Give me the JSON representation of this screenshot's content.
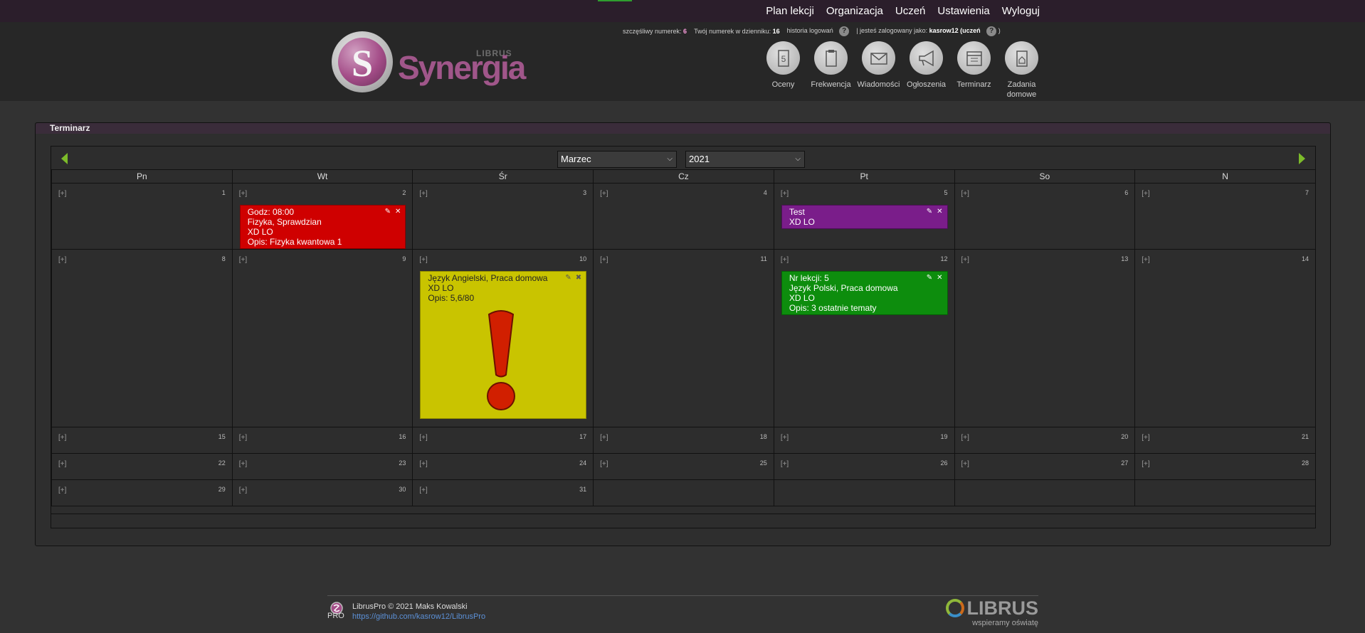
{
  "topnav": {
    "items": [
      "Plan lekcji",
      "Organizacja",
      "Uczeń",
      "Ustawienia",
      "Wyloguj"
    ]
  },
  "header": {
    "logo_text": "Synergia",
    "logo_small": "LIBRUS",
    "info": {
      "lucky_label": "szczęśliwy numerek:",
      "lucky_value": "6",
      "number_label": "Twój numerek w dzienniku:",
      "number_value": "16",
      "history_label": "historia logowań",
      "logged_prefix": "| jesteś zalogowany jako:",
      "logged_user": "kasrow12 (uczeń",
      "logged_suffix": ")"
    },
    "modules": [
      {
        "label": "Oceny",
        "icon": "grades-icon"
      },
      {
        "label": "Frekwencja",
        "icon": "attendance-icon"
      },
      {
        "label": "Wiadomości",
        "icon": "messages-icon"
      },
      {
        "label": "Ogłoszenia",
        "icon": "announcements-icon"
      },
      {
        "label": "Terminarz",
        "icon": "calendar-icon"
      },
      {
        "label": "Zadania domowe",
        "icon": "homework-icon"
      }
    ]
  },
  "panel": {
    "title": "Terminarz",
    "month": "Marzec",
    "year": "2021",
    "weekdays": [
      "Pn",
      "Wt",
      "Śr",
      "Cz",
      "Pt",
      "So",
      "N"
    ],
    "add_label": "[+]",
    "days": [
      "1",
      "2",
      "3",
      "4",
      "5",
      "6",
      "7",
      "8",
      "9",
      "10",
      "11",
      "12",
      "13",
      "14",
      "15",
      "16",
      "17",
      "18",
      "19",
      "20",
      "21",
      "22",
      "23",
      "24",
      "25",
      "26",
      "27",
      "28",
      "29",
      "30",
      "31"
    ],
    "events": {
      "d2": {
        "lines": [
          "Godz: 08:00",
          "Fizyka, Sprawdzian",
          "XD LO",
          "Opis: Fizyka kwantowa 1"
        ],
        "color": "#cf0000"
      },
      "d5": {
        "lines": [
          "Test",
          "XD LO"
        ],
        "color": "#7a1d8a"
      },
      "d10": {
        "lines": [
          "Język Angielski, Praca domowa",
          "XD LO",
          "Opis: 5,6/80"
        ],
        "color": "#c9c400"
      },
      "d12": {
        "lines": [
          "Nr lekcji: 5",
          "Język Polski, Praca domowa",
          "XD LO",
          "Opis: 3 ostatnie tematy"
        ],
        "color": "#0d8d0d"
      }
    }
  },
  "footer": {
    "copyright": "LibrusPro © 2021 Maks Kowalski",
    "link": "https://github.com/kasrow12/LibrusPro",
    "pro_label": "PRO",
    "brand": "LIBRUS",
    "brand_tagline": "wspieramy oświatę"
  }
}
